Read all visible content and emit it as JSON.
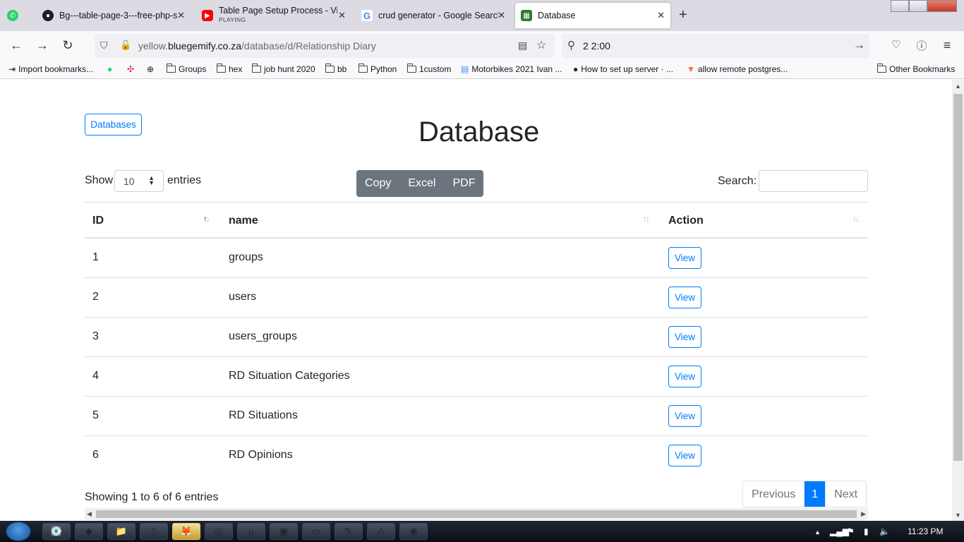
{
  "browser": {
    "tabs": [
      {
        "title": "",
        "icon": "whatsapp-icon",
        "x": 0
      },
      {
        "title": "Bg---table-page-3---free-php-s",
        "icon": "github-icon"
      },
      {
        "title": "Table Page Setup Process - Vid",
        "subtitle": "PLAYING",
        "icon": "youtube-icon"
      },
      {
        "title": "crud generator - Google Search",
        "icon": "google-icon"
      },
      {
        "title": "Database",
        "icon": "database-icon",
        "active": true
      }
    ],
    "url_host": "yellow.",
    "url_domain": "bluegemify.co.za",
    "url_path": "/database/d/Relationship Diary",
    "search_query": "2 2:00",
    "bookmarks": [
      {
        "label": "Import bookmarks...",
        "icon": "import-icon"
      },
      {
        "label": "",
        "icon": "whatsapp-icon"
      },
      {
        "label": "",
        "icon": "slack-icon"
      },
      {
        "label": "",
        "icon": "globe-icon"
      },
      {
        "label": "Groups",
        "icon": "folder-icon"
      },
      {
        "label": "hex",
        "icon": "folder-icon"
      },
      {
        "label": "job hunt 2020",
        "icon": "folder-icon"
      },
      {
        "label": "bb",
        "icon": "folder-icon"
      },
      {
        "label": "Python",
        "icon": "folder-icon"
      },
      {
        "label": "1custom",
        "icon": "folder-icon"
      },
      {
        "label": "Motorbikes 2021 Ivan ...",
        "icon": "docs-icon"
      },
      {
        "label": "How to set up server · ...",
        "icon": "github-icon"
      },
      {
        "label": "allow remote postgres...",
        "icon": "gitlab-icon"
      },
      {
        "label": "Other Bookmarks",
        "icon": "folder-icon"
      }
    ]
  },
  "page": {
    "back_button": "Databases",
    "title": "Database",
    "show_label": "Show",
    "entries_value": "10",
    "entries_label": "entries",
    "export_buttons": [
      "Copy",
      "Excel",
      "PDF"
    ],
    "search_label": "Search:",
    "search_value": "",
    "columns": [
      "ID",
      "name",
      "Action"
    ],
    "rows": [
      {
        "id": "1",
        "name": "groups",
        "action": "View"
      },
      {
        "id": "2",
        "name": "users",
        "action": "View"
      },
      {
        "id": "3",
        "name": "users_groups",
        "action": "View"
      },
      {
        "id": "4",
        "name": "RD Situation Categories",
        "action": "View"
      },
      {
        "id": "5",
        "name": "RD Situations",
        "action": "View"
      },
      {
        "id": "6",
        "name": "RD Opinions",
        "action": "View"
      }
    ],
    "info": "Showing 1 to 6 of 6 entries",
    "pagination": {
      "previous": "Previous",
      "current": "1",
      "next": "Next"
    }
  },
  "taskbar": {
    "clock": "11:23 PM"
  },
  "colors": {
    "primary": "#007bff",
    "secondary": "#6c757d",
    "tab_strip": "#dcdbe4"
  }
}
